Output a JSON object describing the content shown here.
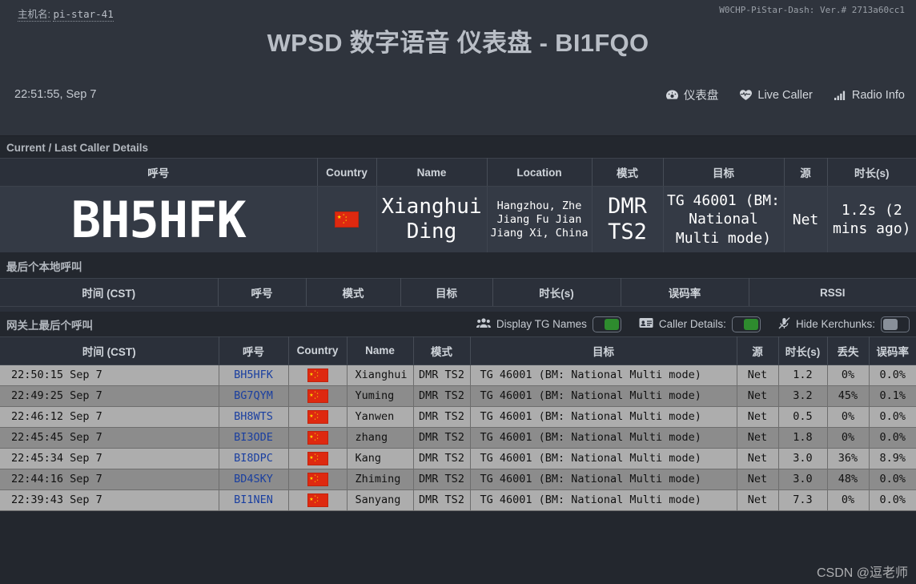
{
  "header": {
    "hostname_label": "主机名:",
    "hostname_value": "pi-star-41",
    "version": "W0CHP-PiStar-Dash: Ver.# 2713a60cc1",
    "title": "WPSD 数字语音 仪表盘 - BI1FQO",
    "clock": "22:51:55, Sep 7",
    "nav": [
      {
        "label": "仪表盘",
        "icon": "gauge-icon"
      },
      {
        "label": "Live Caller",
        "icon": "heart-pulse-icon"
      },
      {
        "label": "Radio Info",
        "icon": "signal-bars-icon"
      }
    ]
  },
  "current_caller": {
    "section_title": "Current / Last Caller Details",
    "columns": [
      "呼号",
      "Country",
      "Name",
      "Location",
      "模式",
      "目标",
      "源",
      "时长(s)"
    ],
    "row": {
      "callsign": "BH5HFK",
      "country": "flag-cn",
      "name": "Xianghui Ding",
      "location": "Hangzhou, Zhe Jiang Fu Jian Jiang Xi, China",
      "mode": "DMR TS2",
      "target": "TG 46001 (BM: National Multi mode)",
      "source": "Net",
      "duration": "1.2s (2 mins ago)"
    }
  },
  "local_calls": {
    "section_title": "最后个本地呼叫",
    "columns": [
      "时间 (CST)",
      "呼号",
      "模式",
      "目标",
      "时长(s)",
      "误码率",
      "RSSI"
    ],
    "rows": []
  },
  "gateway_calls": {
    "section_title": "网关上最后个呼叫",
    "toggles": [
      {
        "label": "Display TG Names",
        "icon": "users-icon",
        "on": true
      },
      {
        "label": "Caller Details:",
        "icon": "id-card-icon",
        "on": true
      },
      {
        "label": "Hide Kerchunks:",
        "icon": "microphone-slash-icon",
        "on": false
      }
    ],
    "columns": [
      "时间 (CST)",
      "呼号",
      "Country",
      "Name",
      "模式",
      "目标",
      "源",
      "时长(s)",
      "丢失",
      "误码率"
    ],
    "rows": [
      {
        "time": "22:50:15 Sep 7",
        "callsign": "BH5HFK",
        "country": "flag-cn",
        "name": "Xianghui",
        "mode": "DMR TS2",
        "target": "TG 46001 (BM: National Multi mode)",
        "source": "Net",
        "duration": "1.2",
        "loss": "0%",
        "loss_color": "normal",
        "ber": "0.0%",
        "ber_color": "normal"
      },
      {
        "time": "22:49:25 Sep 7",
        "callsign": "BG7QYM",
        "country": "flag-cn",
        "name": "Yuming",
        "mode": "DMR TS2",
        "target": "TG 46001 (BM: National Multi mode)",
        "source": "Net",
        "duration": "3.2",
        "loss": "45%",
        "loss_color": "red",
        "ber": "0.1%",
        "ber_color": "green"
      },
      {
        "time": "22:46:12 Sep 7",
        "callsign": "BH8WTS",
        "country": "flag-cn",
        "name": "Yanwen",
        "mode": "DMR TS2",
        "target": "TG 46001 (BM: National Multi mode)",
        "source": "Net",
        "duration": "0.5",
        "loss": "0%",
        "loss_color": "normal",
        "ber": "0.0%",
        "ber_color": "normal"
      },
      {
        "time": "22:45:45 Sep 7",
        "callsign": "BI3ODE",
        "country": "flag-cn",
        "name": "zhang",
        "mode": "DMR TS2",
        "target": "TG 46001 (BM: National Multi mode)",
        "source": "Net",
        "duration": "1.8",
        "loss": "0%",
        "loss_color": "normal",
        "ber": "0.0%",
        "ber_color": "normal"
      },
      {
        "time": "22:45:34 Sep 7",
        "callsign": "BI8DPC",
        "country": "flag-cn",
        "name": "Kang",
        "mode": "DMR TS2",
        "target": "TG 46001 (BM: National Multi mode)",
        "source": "Net",
        "duration": "3.0",
        "loss": "36%",
        "loss_color": "red",
        "ber": "8.9%",
        "ber_color": "red"
      },
      {
        "time": "22:44:16 Sep 7",
        "callsign": "BD4SKY",
        "country": "flag-cn",
        "name": "Zhiming",
        "mode": "DMR TS2",
        "target": "TG 46001 (BM: National Multi mode)",
        "source": "Net",
        "duration": "3.0",
        "loss": "48%",
        "loss_color": "red",
        "ber": "0.0%",
        "ber_color": "normal"
      },
      {
        "time": "22:39:43 Sep 7",
        "callsign": "BI1NEN",
        "country": "flag-cn",
        "name": "Sanyang",
        "mode": "DMR TS2",
        "target": "TG 46001 (BM: National Multi mode)",
        "source": "Net",
        "duration": "7.3",
        "loss": "0%",
        "loss_color": "normal",
        "ber": "0.0%",
        "ber_color": "normal"
      }
    ]
  },
  "watermark": "CSDN @逗老师"
}
